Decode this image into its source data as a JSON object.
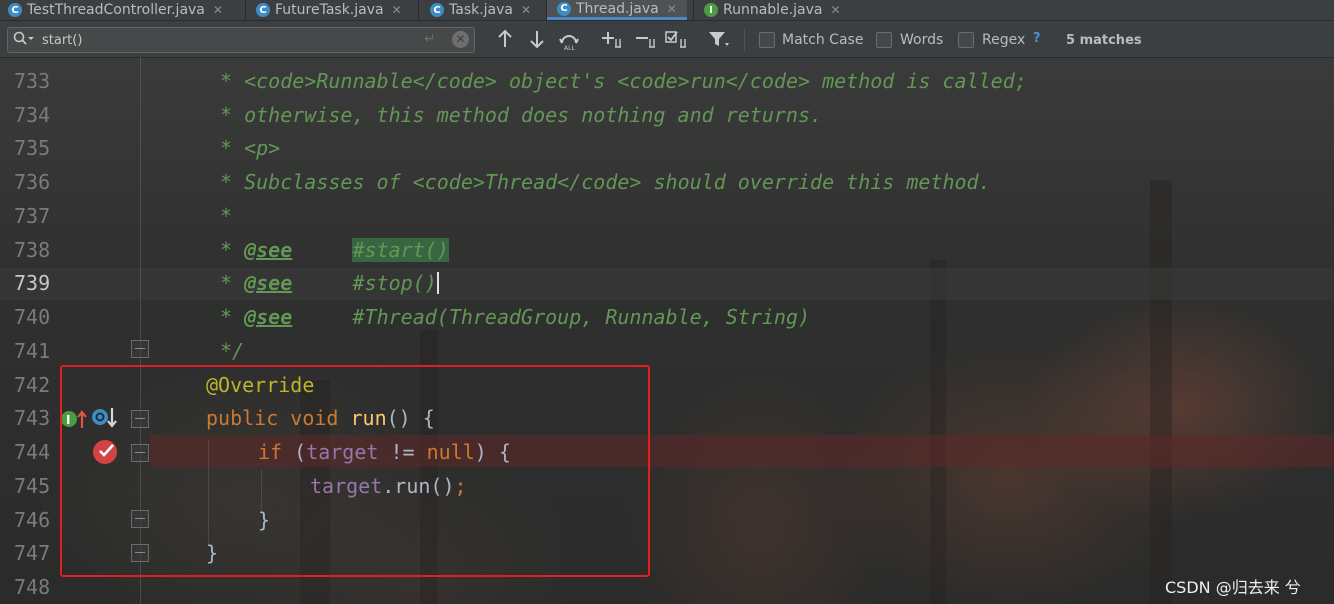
{
  "tabs": [
    {
      "label": "TestThreadController.java",
      "icon": "class-icon",
      "active": false
    },
    {
      "label": "FutureTask.java",
      "icon": "class-icon",
      "active": false
    },
    {
      "label": "Task.java",
      "icon": "class-icon",
      "active": false
    },
    {
      "label": "Thread.java",
      "icon": "class-icon",
      "active": true
    },
    {
      "label": "Runnable.java",
      "icon": "interface-icon",
      "active": false
    }
  ],
  "search": {
    "value": "start()",
    "match_case_label": "Match Case",
    "words_label": "Words",
    "regex_label": "Regex",
    "help_label": "?",
    "matches_label": "5 matches"
  },
  "editor": {
    "line_numbers": [
      "733",
      "734",
      "735",
      "736",
      "737",
      "738",
      "739",
      "740",
      "741",
      "742",
      "743",
      "744",
      "745",
      "746",
      "747",
      "748"
    ],
    "current_line": "739",
    "lines": {
      "l733": {
        "star": "* ",
        "code_open": "<code>",
        "runnable": "Runnable",
        "code_close": "</code>",
        "mid": " object's ",
        "code_open2": "<code>",
        "run": "run",
        "code_close2": "</code>",
        "end": " method is called;"
      },
      "l734": "* otherwise, this method does nothing and returns.",
      "l735": "* <p>",
      "l736": {
        "pre": "* Subclasses of ",
        "code_open": "<code>",
        "thread": "Thread",
        "code_close": "</code>",
        "end": " should override this method."
      },
      "l737": "*",
      "l738": {
        "star": "* ",
        "tag": "@see",
        "gap": "     ",
        "ref": "#start()"
      },
      "l739": {
        "star": "* ",
        "tag": "@see",
        "gap": "     ",
        "ref": "#stop()"
      },
      "l740": {
        "star": "* ",
        "tag": "@see",
        "gap": "     ",
        "ref": "#Thread(ThreadGroup, Runnable, String)"
      },
      "l741": "*/",
      "l742": "@Override",
      "l743": {
        "kw1": "public",
        "kw2": "void",
        "name": "run",
        "rest": "() {"
      },
      "l744": {
        "kw": "if",
        "open": " (",
        "field": "target",
        "op": " != ",
        "null": "null",
        "close": ") {"
      },
      "l745": {
        "field": "target",
        "call": ".run()",
        "semi": ";"
      },
      "l746": "}",
      "l747": "}"
    }
  },
  "colors": {
    "highlight_box": "#e41e1e",
    "doc_comment": "#629755",
    "keyword": "#cc7832",
    "field": "#9876aa"
  },
  "watermark": "CSDN @归去来 兮"
}
